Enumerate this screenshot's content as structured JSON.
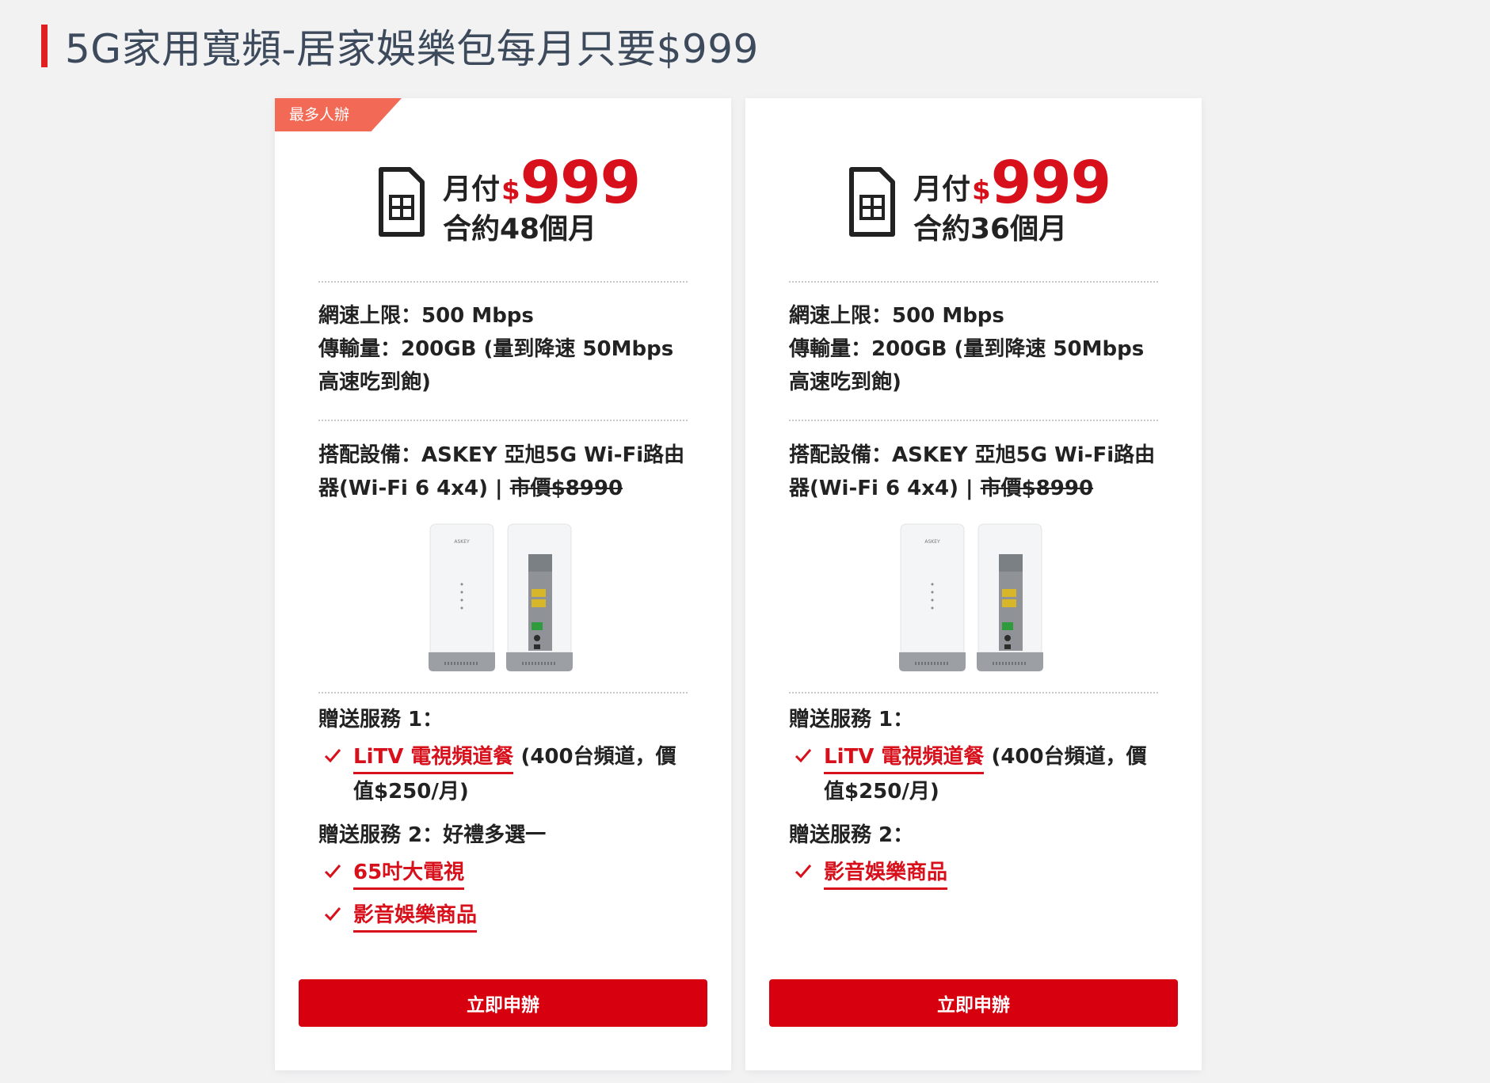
{
  "page": {
    "title": "5G家用寬頻-居家娛樂包每月只要$999",
    "accent_color": "#d7101b"
  },
  "plans": [
    {
      "badge": "最多人辦",
      "price_label": "月付",
      "currency": "$",
      "amount": "999",
      "contract": "合約48個月",
      "speed": "網速上限：500 Mbps",
      "data_usage": "傳輸量：200GB (量到降速 50Mbps 高速吃到飽)",
      "equipment_text": "搭配設備：ASKEY 亞旭5G Wi-Fi路由器(Wi-Fi 6 4x4) | ",
      "equipment_price": "市價$8990",
      "gift1_title": "贈送服務 1：",
      "gift1_link": "LiTV 電視頻道餐",
      "gift1_note": " (400台頻道，價值$250/月)",
      "gift2_title": "贈送服務 2：好禮多選一",
      "gift2_options": [
        "65吋大電視",
        "影音娛樂商品"
      ],
      "button": "立即申辦"
    },
    {
      "price_label": "月付",
      "currency": "$",
      "amount": "999",
      "contract": "合約36個月",
      "speed": "網速上限：500 Mbps",
      "data_usage": "傳輸量：200GB (量到降速 50Mbps 高速吃到飽)",
      "equipment_text": "搭配設備：ASKEY 亞旭5G Wi-Fi路由器(Wi-Fi 6 4x4) | ",
      "equipment_price": "市價$8990",
      "gift1_title": "贈送服務 1：",
      "gift1_link": "LiTV 電視頻道餐",
      "gift1_note": " (400台頻道，價值$250/月)",
      "gift2_title": "贈送服務 2：",
      "gift2_options": [
        "影音娛樂商品"
      ],
      "button": "立即申辦"
    }
  ]
}
